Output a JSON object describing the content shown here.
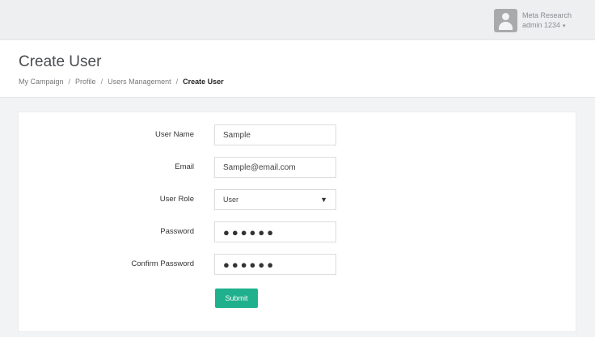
{
  "topbar": {
    "org_name": "Meta Research",
    "user_name": "admin 1234",
    "caret": "▾"
  },
  "header": {
    "title": "Create User",
    "breadcrumb": [
      {
        "label": "My Campaign"
      },
      {
        "label": "Profile"
      },
      {
        "label": "Users Management"
      },
      {
        "label": "Create User"
      }
    ],
    "separator": "/"
  },
  "form": {
    "username": {
      "label": "User Name",
      "value": "Sample"
    },
    "email": {
      "label": "Email",
      "value": "Sample@email.com"
    },
    "role": {
      "label": "User Role",
      "value": "User",
      "arrow": "▼"
    },
    "password": {
      "label": "Password",
      "masked": "●●●●●●"
    },
    "confirm_password": {
      "label": "Confirm Password",
      "masked": "●●●●●●"
    },
    "submit_label": "Submit"
  },
  "colors": {
    "accent": "#1fb08d",
    "background": "#f2f3f5"
  },
  "icons": {
    "avatar": "user-avatar-icon",
    "caret": "caret-down-icon",
    "select_arrow": "dropdown-arrow-icon"
  }
}
